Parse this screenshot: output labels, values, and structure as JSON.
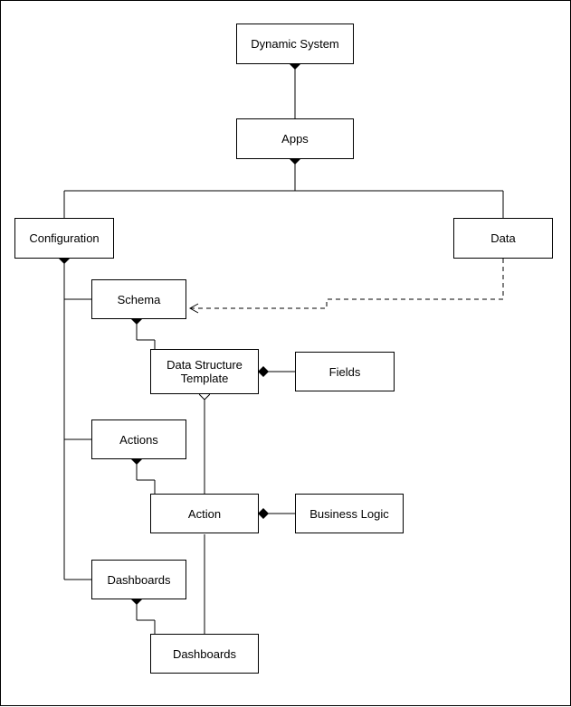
{
  "nodes": {
    "dynamic_system": "Dynamic System",
    "apps": "Apps",
    "configuration": "Configuration",
    "data": "Data",
    "schema": "Schema",
    "data_structure_template": "Data Structure\nTemplate",
    "fields": "Fields",
    "actions": "Actions",
    "action": "Action",
    "business_logic": "Business Logic",
    "dashboards1": "Dashboards",
    "dashboards2": "Dashboards"
  }
}
